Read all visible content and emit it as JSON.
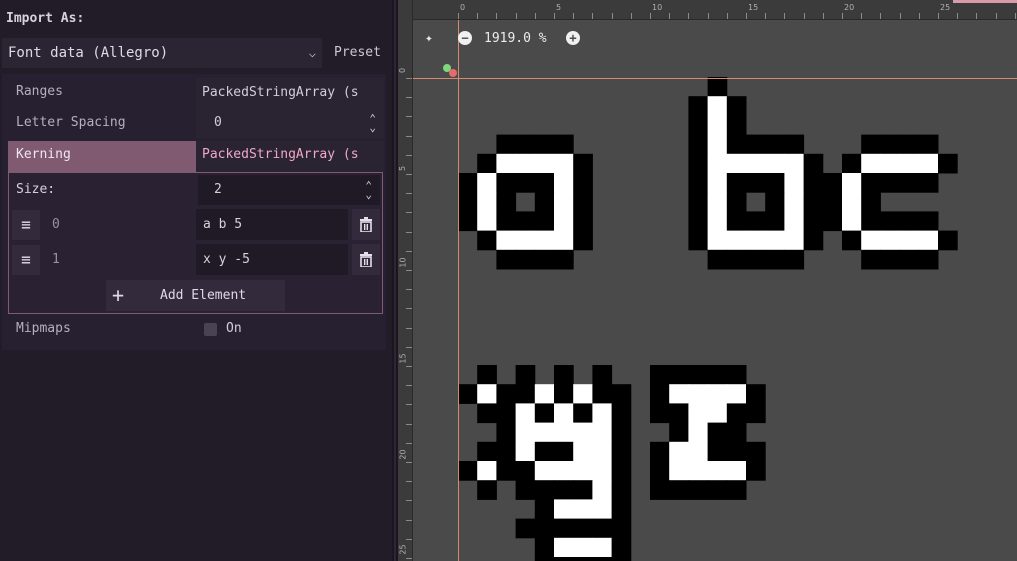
{
  "import": {
    "label": "Import As:",
    "format_value": "Font data (Allegro)",
    "preset_label": "Preset"
  },
  "inspector": {
    "ranges_label": "Ranges",
    "ranges_value": "PackedStringArray (s",
    "letter_spacing_label": "Letter Spacing",
    "letter_spacing_value": "0",
    "kerning_label": "Kerning",
    "kerning_value": "PackedStringArray (s",
    "size_label": "Size:",
    "size_value": "2",
    "elements": [
      {
        "index": "0",
        "value": "a b 5"
      },
      {
        "index": "1",
        "value": "x y -5"
      }
    ],
    "add_element_label": "Add Element",
    "mipmaps_label": "Mipmaps",
    "mipmaps_check_label": "On"
  },
  "viewport": {
    "zoom_text": "1919.0 %",
    "ruler_top_labels": [
      "0",
      "5",
      "10",
      "15",
      "20",
      "25"
    ],
    "ruler_left_labels": [
      "0",
      "5",
      "10",
      "15",
      "20",
      "25"
    ],
    "background_color": "#4a4a4a",
    "guide_color": "#d48a70"
  }
}
